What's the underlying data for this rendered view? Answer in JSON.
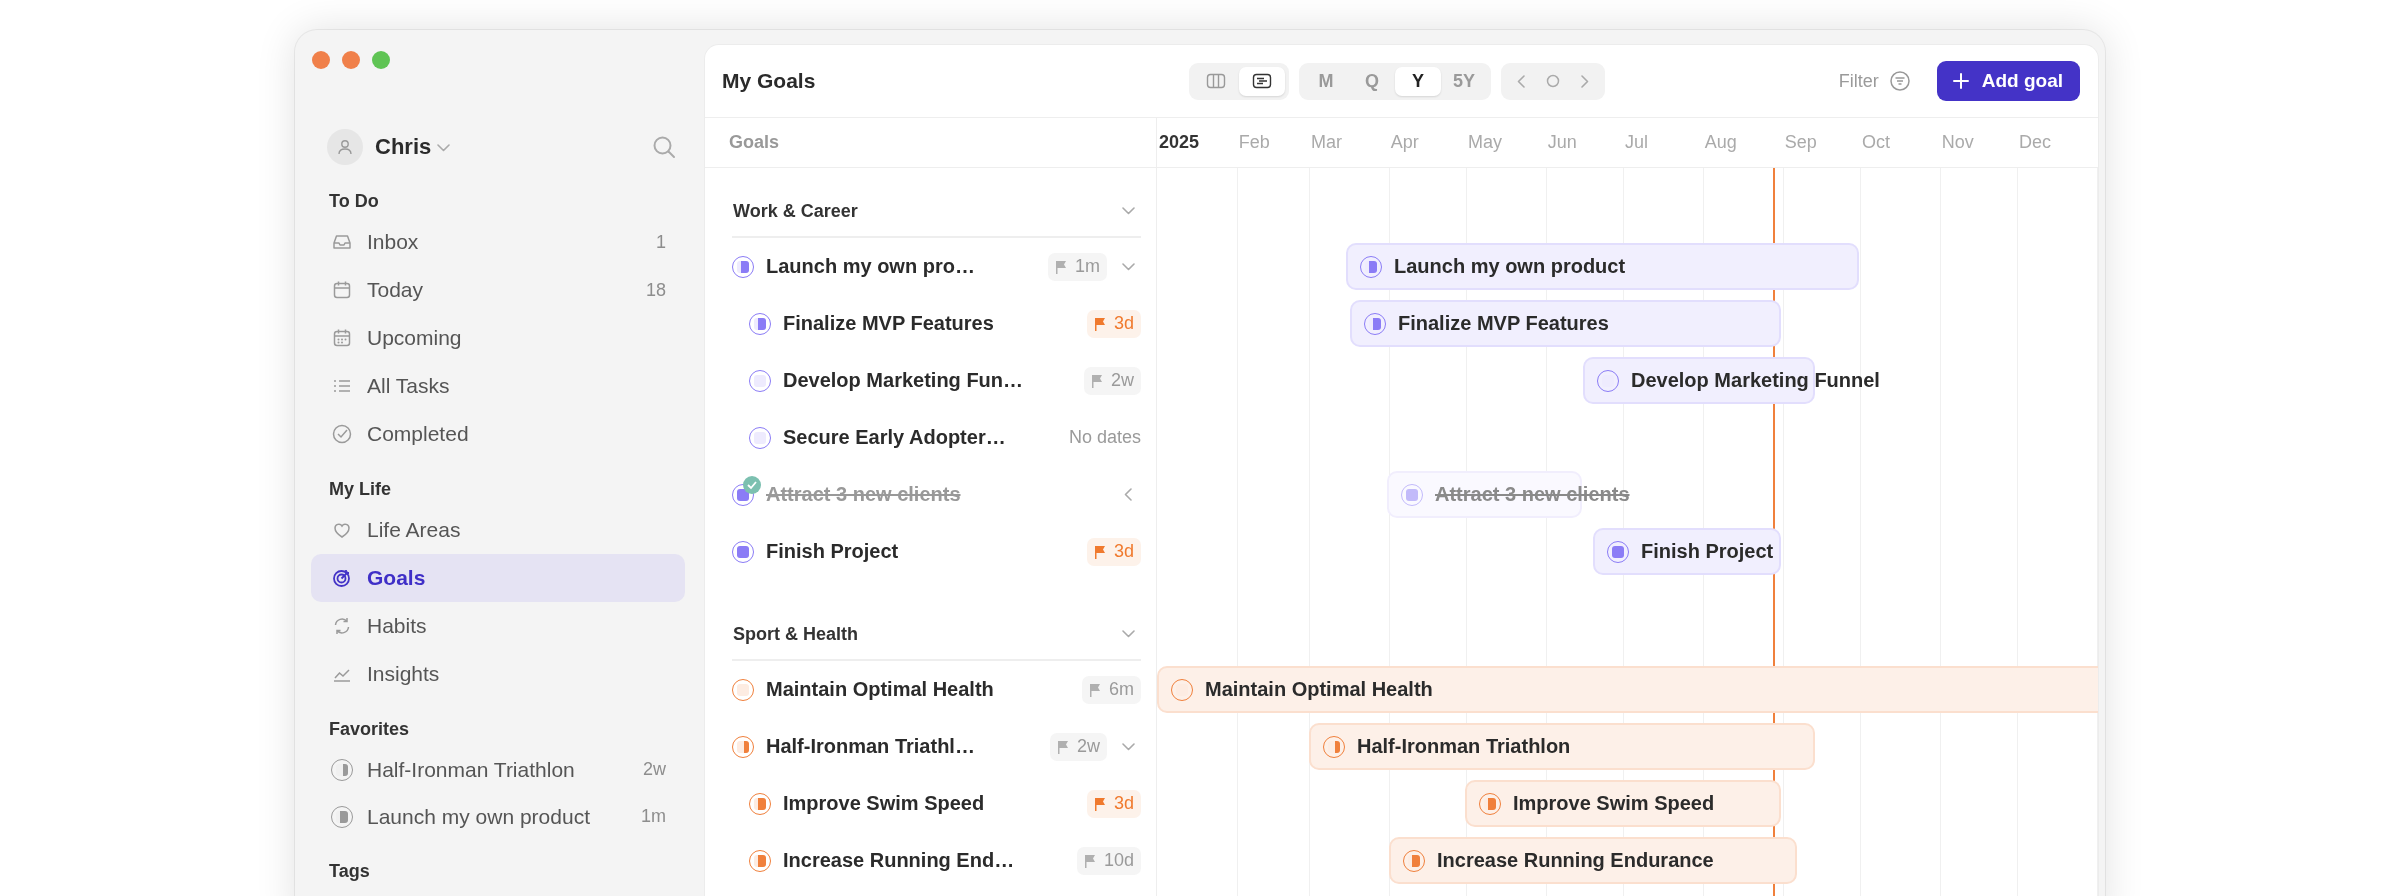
{
  "sidebar": {
    "user": {
      "name": "Chris"
    },
    "sections": [
      {
        "title": "To Do",
        "items": [
          {
            "label": "Inbox",
            "count": "1",
            "selected": false
          },
          {
            "label": "Today",
            "count": "18",
            "selected": false
          },
          {
            "label": "Upcoming",
            "selected": false
          },
          {
            "label": "All Tasks",
            "selected": false
          },
          {
            "label": "Completed",
            "selected": false
          }
        ]
      },
      {
        "title": "My Life",
        "items": [
          {
            "label": "Life Areas",
            "selected": false
          },
          {
            "label": "Goals",
            "selected": true
          },
          {
            "label": "Habits",
            "selected": false
          },
          {
            "label": "Insights",
            "selected": false
          }
        ]
      },
      {
        "title": "Favorites",
        "items": [
          {
            "kind": "goal",
            "label": "Half-Ironman Triathlon",
            "count": "2w",
            "level": 0.4,
            "selected": false
          },
          {
            "kind": "goal",
            "label": "Launch my own product",
            "count": "1m",
            "level": 0.7,
            "selected": false
          }
        ]
      },
      {
        "title": "Tags"
      }
    ]
  },
  "header": {
    "title": "My Goals",
    "views": [
      {
        "selected": false
      },
      {
        "selected": true
      }
    ],
    "ranges": [
      {
        "label": "M",
        "selected": false
      },
      {
        "label": "Q",
        "selected": false
      },
      {
        "label": "Y",
        "selected": true
      },
      {
        "label": "5Y",
        "selected": false
      }
    ],
    "filter": "Filter",
    "add_button": "Add goal"
  },
  "columns": {
    "goals": "Goals",
    "year": "2025",
    "months": [
      "Feb",
      "Mar",
      "Apr",
      "May",
      "Jun",
      "Jul",
      "Aug",
      "Sep",
      "Oct",
      "Nov",
      "Dec"
    ]
  },
  "groups": [
    {
      "title": "Work & Career",
      "color": "#8b7cf6",
      "expanded": true,
      "goals": [
        {
          "title": "Launch my own pro…",
          "bar_title": "Launch my own product",
          "level": 0.7,
          "completed": false,
          "expanded": true,
          "due": {
            "kind": "flag",
            "text": "1m"
          },
          "children": [
            {
              "title": "Finalize MVP Features",
              "bar_title": "Finalize MVP Features",
              "level": 0.7,
              "completed": false,
              "due": {
                "kind": "urgent",
                "text": "3d"
              }
            },
            {
              "title": "Develop Marketing Fun…",
              "bar_title": "Develop Marketing Funnel",
              "completed": false,
              "due": {
                "kind": "flag",
                "text": "2w"
              }
            },
            {
              "title": "Secure Early Adopter…",
              "completed": false,
              "due": {
                "kind": "plain",
                "text": "No dates"
              }
            }
          ]
        },
        {
          "title": "Attract 3 new clients",
          "bar_title": "Attract 3 new clients",
          "level": 1,
          "completed": true,
          "expanded": false
        },
        {
          "title": "Finish Project",
          "bar_title": "Finish Project",
          "level": 1,
          "completed": false,
          "due": {
            "kind": "urgent",
            "text": "3d"
          }
        }
      ]
    },
    {
      "title": "Sport & Health",
      "color": "#f0803c",
      "expanded": true,
      "goals": [
        {
          "title": "Maintain Optimal Health",
          "bar_title": "Maintain Optimal Health",
          "completed": false,
          "due": {
            "kind": "flag",
            "text": "6m"
          }
        },
        {
          "title": "Half-Ironman Triathl…",
          "bar_title": "Half-Ironman Triathlon",
          "level": 0.4,
          "completed": false,
          "expanded": true,
          "due": {
            "kind": "flag",
            "text": "2w"
          },
          "children": [
            {
              "title": "Improve Swim Speed",
              "bar_title": "Improve Swim Speed",
              "level": 0.7,
              "completed": false,
              "due": {
                "kind": "urgent",
                "text": "3d"
              }
            },
            {
              "title": "Increase Running End…",
              "bar_title": "Increase Running Endurance",
              "level": 0.7,
              "completed": false,
              "due": {
                "kind": "flag",
                "text": "10d"
              }
            }
          ]
        }
      ]
    }
  ]
}
